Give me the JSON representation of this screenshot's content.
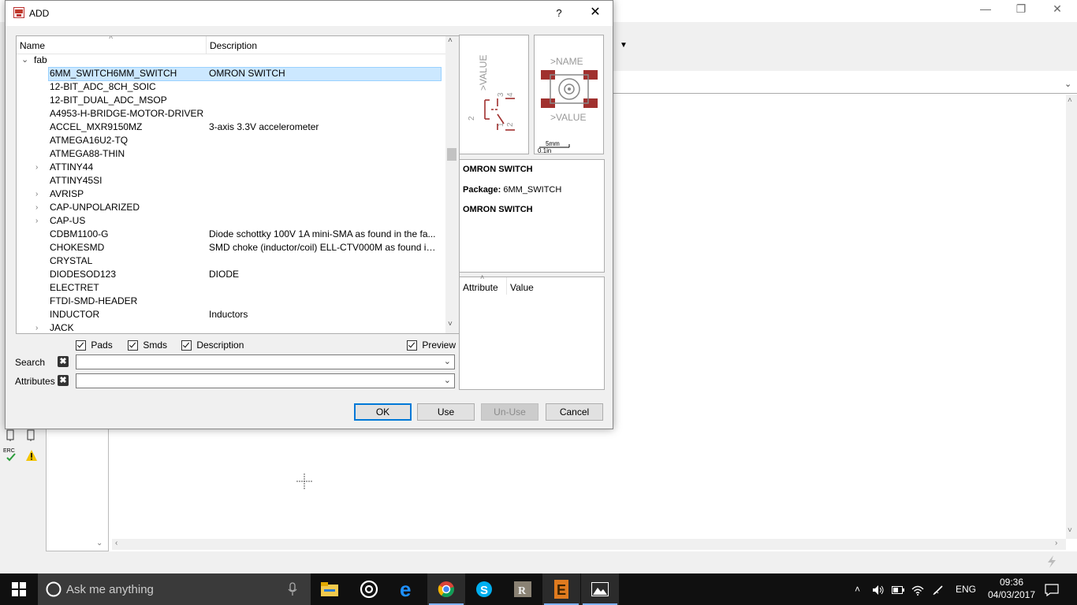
{
  "dialog": {
    "title": "ADD",
    "help_label": "?",
    "close_label": "✕",
    "columns": {
      "name": "Name",
      "description": "Description"
    },
    "root": "fab",
    "items": [
      {
        "name": "6MM_SWITCH6MM_SWITCH",
        "desc": "OMRON SWITCH",
        "expandable": false,
        "selected": true
      },
      {
        "name": "12-BIT_ADC_8CH_SOIC",
        "desc": "",
        "expandable": false
      },
      {
        "name": "12-BIT_DUAL_ADC_MSOP",
        "desc": "",
        "expandable": false
      },
      {
        "name": "A4953-H-BRIDGE-MOTOR-DRIVER",
        "desc": "",
        "expandable": false
      },
      {
        "name": "ACCEL_MXR9150MZ",
        "desc": "3-axis 3.3V accelerometer",
        "expandable": false
      },
      {
        "name": "ATMEGA16U2-TQ",
        "desc": "",
        "expandable": false
      },
      {
        "name": "ATMEGA88-THIN",
        "desc": "",
        "expandable": false
      },
      {
        "name": "ATTINY44",
        "desc": "",
        "expandable": true
      },
      {
        "name": "ATTINY45SI",
        "desc": "",
        "expandable": false
      },
      {
        "name": "AVRISP",
        "desc": "",
        "expandable": true
      },
      {
        "name": "CAP-UNPOLARIZED",
        "desc": "",
        "expandable": true
      },
      {
        "name": "CAP-US",
        "desc": "",
        "expandable": true
      },
      {
        "name": "CDBM1100-G",
        "desc": "Diode schottky 100V 1A mini-SMA as found in the fa...",
        "expandable": false
      },
      {
        "name": "CHOKESMD",
        "desc": "SMD choke (inductor/coil) ELL-CTV000M as found in...",
        "expandable": false
      },
      {
        "name": "CRYSTAL",
        "desc": "",
        "expandable": false
      },
      {
        "name": "DIODESOD123",
        "desc": "DIODE",
        "expandable": false
      },
      {
        "name": "ELECTRET",
        "desc": "",
        "expandable": false
      },
      {
        "name": "FTDI-SMD-HEADER",
        "desc": "",
        "expandable": false
      },
      {
        "name": "INDUCTOR",
        "desc": "Inductors",
        "expandable": false
      },
      {
        "name": "JACK",
        "desc": "",
        "expandable": true
      }
    ],
    "checkboxes": {
      "pads": "Pads",
      "smds": "Smds",
      "description": "Description",
      "preview": "Preview"
    },
    "search_label": "Search",
    "attributes_label": "Attributes",
    "search_value": "",
    "attributes_value": "",
    "preview": {
      "symbol_value": ">VALUE",
      "symbol_pins": [
        "2",
        "1",
        "2",
        "3",
        "4"
      ],
      "package_name": ">NAME",
      "package_value": ">VALUE",
      "scale_mm": "5mm",
      "scale_in": "0.1in"
    },
    "info": {
      "heading": "OMRON SWITCH",
      "package_label": "Package:",
      "package_value": "6MM_SWITCH",
      "description": "OMRON SWITCH"
    },
    "attr_columns": {
      "attribute": "Attribute",
      "value": "Value"
    },
    "buttons": {
      "ok": "OK",
      "use": "Use",
      "unuse": "Un-Use",
      "cancel": "Cancel"
    }
  },
  "background": {
    "left_labels": {
      "erc": "ERC"
    }
  },
  "taskbar": {
    "search_placeholder": "Ask me anything",
    "language": "ENG",
    "time": "09:36",
    "date": "04/03/2017"
  },
  "colors": {
    "selection": "#cce8ff",
    "accent": "#0078d7",
    "taskbar": "#101010",
    "symbol_red": "#a0302e"
  }
}
